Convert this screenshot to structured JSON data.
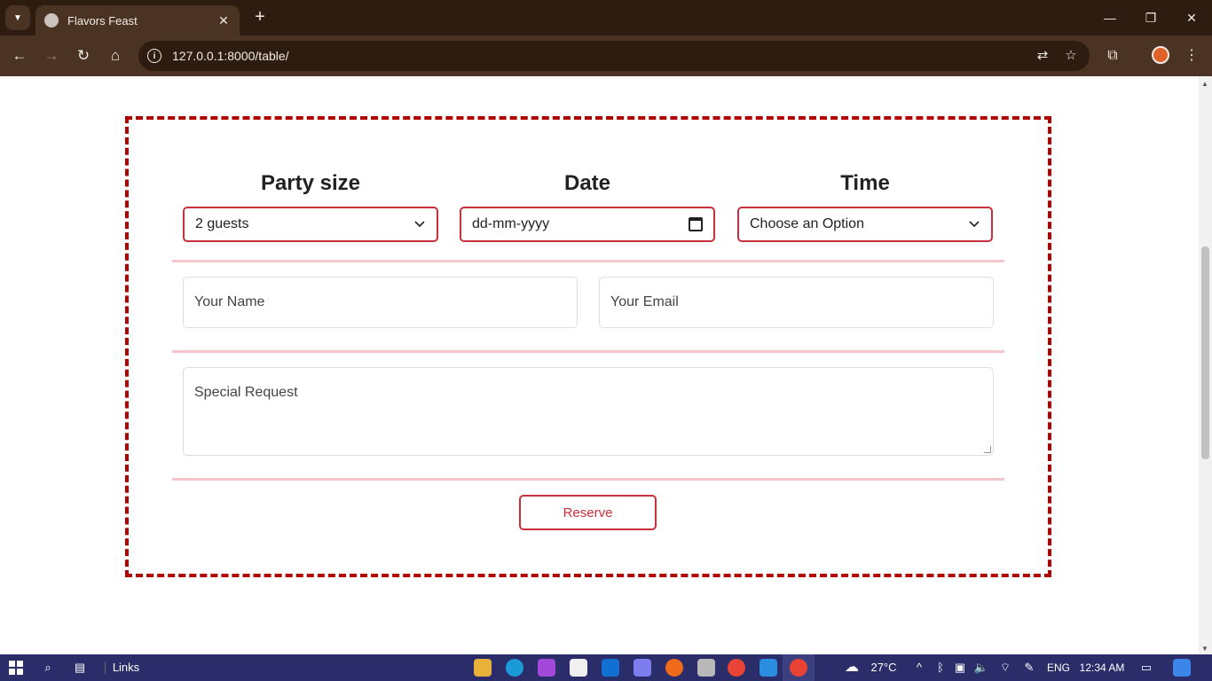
{
  "browser": {
    "tab_title": "Flavors Feast",
    "tab_close": "✕",
    "new_tab": "+",
    "url": "127.0.0.1:8000/table/",
    "window_controls": {
      "minimize": "—",
      "restore": "❐",
      "close": "✕"
    },
    "icons": [
      "back-icon",
      "forward-icon",
      "reload-icon",
      "home-icon",
      "site-info-icon",
      "translate-icon",
      "star-icon",
      "extensions-icon",
      "profile-icon",
      "menu-icon"
    ]
  },
  "form": {
    "party_size": {
      "label": "Party size",
      "value": "2 guests"
    },
    "date": {
      "label": "Date",
      "placeholder": "dd-mm-yyyy"
    },
    "time": {
      "label": "Time",
      "value": "Choose an Option"
    },
    "name_placeholder": "Your Name",
    "email_placeholder": "Your Email",
    "request_placeholder": "Special Request",
    "reserve_label": "Reserve",
    "accent_color": "#c8303c",
    "border_color": "#b00000"
  },
  "taskbar": {
    "links_label": "Links",
    "weather": "27°C",
    "language": "ENG",
    "time": "12:34 AM"
  }
}
